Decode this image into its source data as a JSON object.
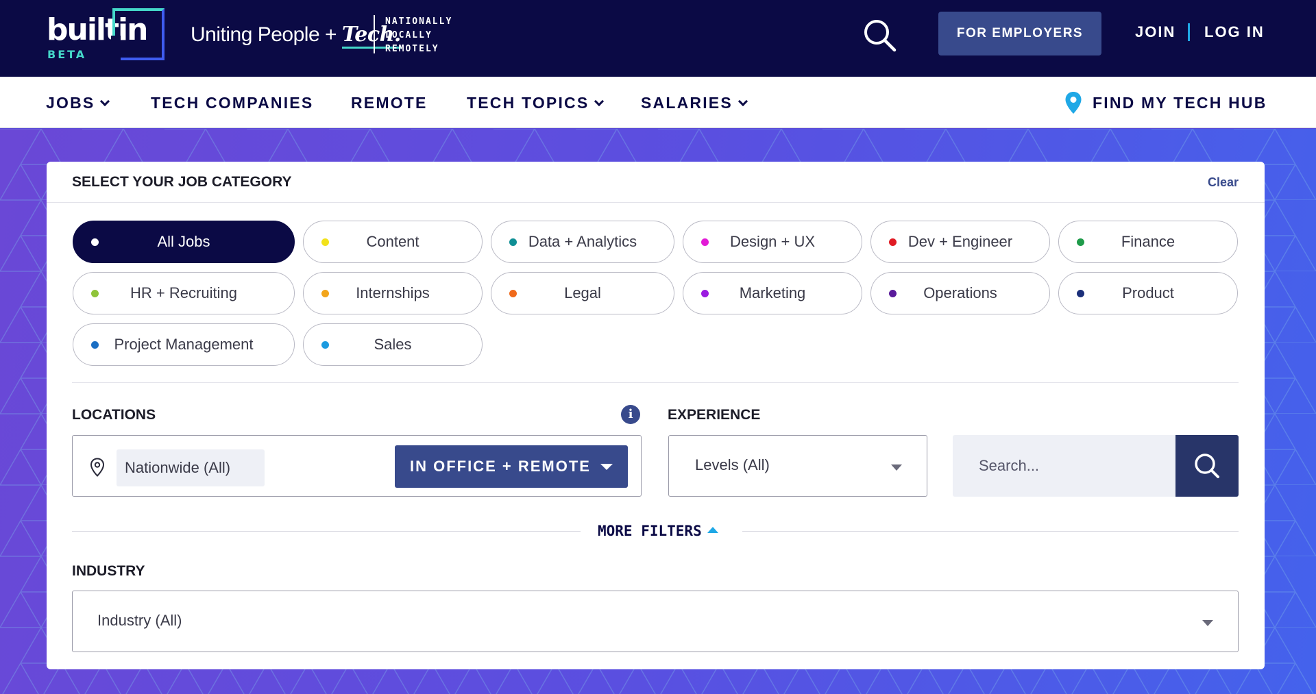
{
  "header": {
    "logo_word": "builtin",
    "logo_badge": "BETA",
    "tagline_prefix": "Uniting People +",
    "tagline_tech": "Tech.",
    "tagline_lines": [
      "NATIONALLY",
      "LOCALLY",
      "REMOTELY"
    ],
    "employers_label": "FOR EMPLOYERS",
    "join_label": "JOIN",
    "login_label": "LOG IN"
  },
  "nav": {
    "items": [
      {
        "label": "JOBS",
        "has_dropdown": true
      },
      {
        "label": "TECH COMPANIES",
        "has_dropdown": false
      },
      {
        "label": "REMOTE",
        "has_dropdown": false
      },
      {
        "label": "TECH TOPICS",
        "has_dropdown": true
      },
      {
        "label": "SALARIES",
        "has_dropdown": true
      }
    ],
    "hub_label": "FIND MY TECH HUB"
  },
  "filters": {
    "category_title": "SELECT YOUR JOB CATEGORY",
    "clear_label": "Clear",
    "categories": [
      {
        "label": "All Jobs",
        "dot": "#ffffff",
        "active": true
      },
      {
        "label": "Content",
        "dot": "#f2e21b",
        "active": false
      },
      {
        "label": "Data + Analytics",
        "dot": "#0f8f95",
        "active": false
      },
      {
        "label": "Design + UX",
        "dot": "#e21bd6",
        "active": false
      },
      {
        "label": "Dev + Engineer",
        "dot": "#e01b24",
        "active": false
      },
      {
        "label": "Finance",
        "dot": "#1f9b4a",
        "active": false
      },
      {
        "label": "HR + Recruiting",
        "dot": "#8fc43a",
        "active": false
      },
      {
        "label": "Internships",
        "dot": "#f2a51b",
        "active": false
      },
      {
        "label": "Legal",
        "dot": "#f06a1b",
        "active": false
      },
      {
        "label": "Marketing",
        "dot": "#9b1be0",
        "active": false
      },
      {
        "label": "Operations",
        "dot": "#5a1b9b",
        "active": false
      },
      {
        "label": "Product",
        "dot": "#1b2f7a",
        "active": false
      },
      {
        "label": "Project Management",
        "dot": "#1b6fc4",
        "active": false
      },
      {
        "label": "Sales",
        "dot": "#1b9be0",
        "active": false
      }
    ],
    "locations_label": "LOCATIONS",
    "location_value": "Nationwide (All)",
    "work_mode_label": "IN OFFICE + REMOTE",
    "experience_label": "EXPERIENCE",
    "experience_value": "Levels (All)",
    "search_placeholder": "Search...",
    "more_filters_label": "MORE FILTERS",
    "industry_label": "INDUSTRY",
    "industry_value": "Industry (All)"
  },
  "colors": {
    "navy": "#0b0a45",
    "accent_blue": "#384a8c",
    "teal": "#45d7c9",
    "link_blue": "#1fa8e6"
  }
}
